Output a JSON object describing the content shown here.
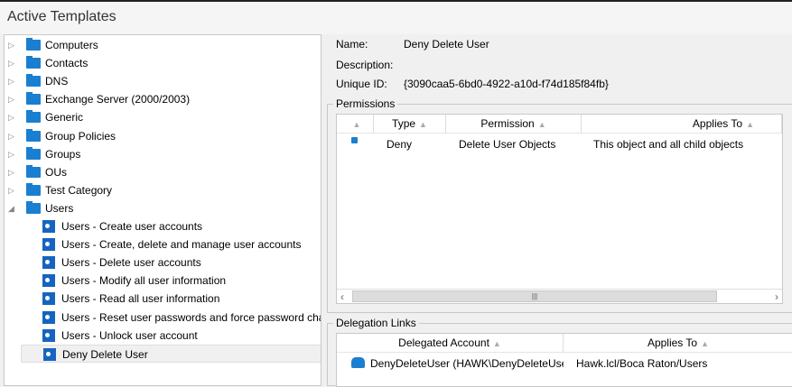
{
  "title": "Active Templates",
  "tree": {
    "folders": [
      {
        "label": "Computers"
      },
      {
        "label": "Contacts"
      },
      {
        "label": "DNS"
      },
      {
        "label": "Exchange Server (2000/2003)"
      },
      {
        "label": "Generic"
      },
      {
        "label": "Group Policies"
      },
      {
        "label": "Groups"
      },
      {
        "label": "OUs"
      },
      {
        "label": "Test Category"
      },
      {
        "label": "Users"
      }
    ],
    "users_children": [
      {
        "label": "Users - Create user accounts"
      },
      {
        "label": "Users - Create, delete and manage user accounts"
      },
      {
        "label": "Users - Delete user accounts"
      },
      {
        "label": "Users - Modify all user information"
      },
      {
        "label": "Users - Read all user information"
      },
      {
        "label": "Users - Reset user passwords and force password change"
      },
      {
        "label": "Users - Unlock user account"
      },
      {
        "label": "Deny Delete User",
        "selected": true
      }
    ]
  },
  "details": {
    "name_label": "Name:",
    "name": "Deny Delete User",
    "description_label": "Description:",
    "description": "",
    "uid_label": "Unique ID:",
    "uid": "{3090caa5-6bd0-4922-a10d-f74d185f84fb}"
  },
  "permissions": {
    "title": "Permissions",
    "columns": [
      "",
      "Type",
      "Permission",
      "Applies To"
    ],
    "rows": [
      {
        "icon": "lock-icon",
        "type": "Deny",
        "permission": "Delete User Objects",
        "applies_to": "This object and all child objects"
      }
    ]
  },
  "delegation": {
    "title": "Delegation Links",
    "columns": [
      "Delegated Account",
      "Applies To"
    ],
    "rows": [
      {
        "icon": "group-icon",
        "account": "DenyDeleteUser (HAWK\\DenyDeleteUser)",
        "applies_to": "Hawk.lcl/Boca Raton/Users"
      }
    ]
  },
  "colors": {
    "folder": "#1a7fd0",
    "template": "#1565c0"
  }
}
